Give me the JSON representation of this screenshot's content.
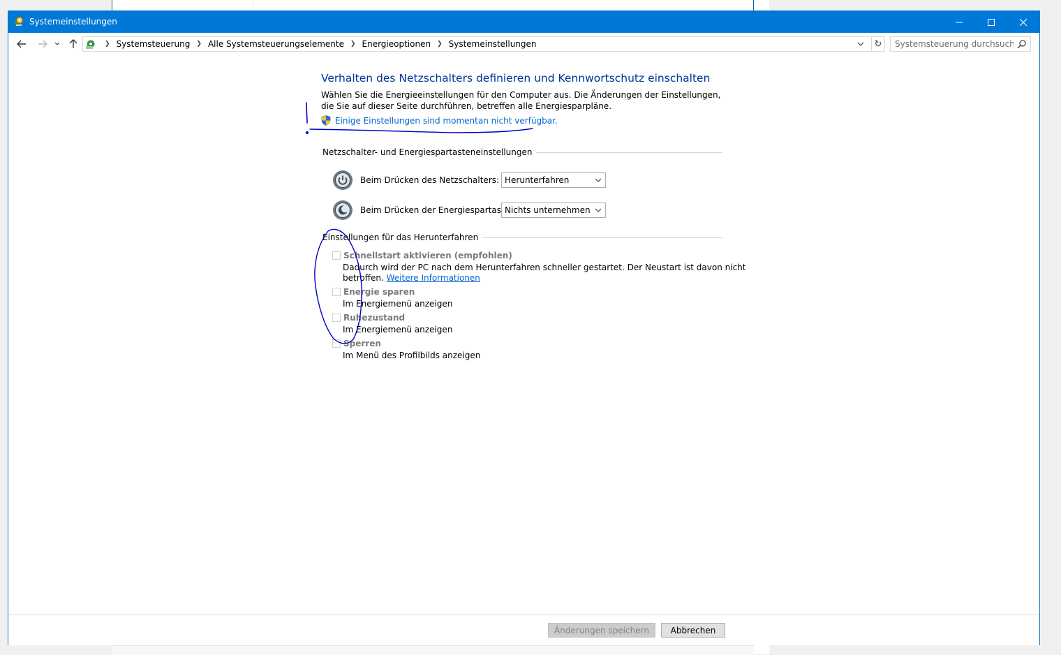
{
  "window": {
    "title": "Systemeinstellungen",
    "controls": {
      "minimize": "minimize",
      "maximize": "maximize",
      "close": "close"
    }
  },
  "navigation": {
    "breadcrumbs": [
      "Systemsteuerung",
      "Alle Systemsteuerungselemente",
      "Energieoptionen",
      "Systemeinstellungen"
    ],
    "search_placeholder": "Systemsteuerung durchsuchen"
  },
  "page": {
    "heading": "Verhalten des Netzschalters definieren und Kennwortschutz einschalten",
    "description": "Wählen Sie die Energieeinstellungen für den Computer aus. Die Änderungen der Einstellungen, die Sie auf dieser Seite durchführen, betreffen alle Energiesparpläne.",
    "unavailable_link": "Einige Einstellungen sind momentan nicht verfügbar.",
    "buttons_section": {
      "label": "Netzschalter- und Energiespartasteneinstellungen",
      "power_button": {
        "label": "Beim Drücken des Netzschalters:",
        "value": "Herunterfahren"
      },
      "sleep_button": {
        "label": "Beim Drücken der Energiespartaste:",
        "value": "Nichts unternehmen"
      }
    },
    "shutdown_section": {
      "label": "Einstellungen für das Herunterfahren",
      "fast_startup": {
        "label": "Schnellstart aktivieren (empfohlen)",
        "desc_line1": "Dadurch wird der PC nach dem Herunterfahren schneller gestartet. Der Neustart ist davon nicht",
        "desc_line2": "betroffen.",
        "more_link": "Weitere Informationen",
        "checked": false
      },
      "sleep": {
        "label": "Energie sparen",
        "desc": "Im Energiemenü anzeigen",
        "checked": false
      },
      "hibernate": {
        "label": "Ruhezustand",
        "desc": "Im Energiemenü anzeigen",
        "checked": false
      },
      "lock": {
        "label": "Sperren",
        "desc": "Im Menü des Profilbilds anzeigen",
        "checked": false
      }
    }
  },
  "footer": {
    "save_label": "Änderungen speichern",
    "cancel_label": "Abbrechen"
  },
  "colors": {
    "titlebar": "#0078d7",
    "heading": "#003399",
    "link": "#0066cc",
    "ink_annotation": "#0000cc"
  }
}
